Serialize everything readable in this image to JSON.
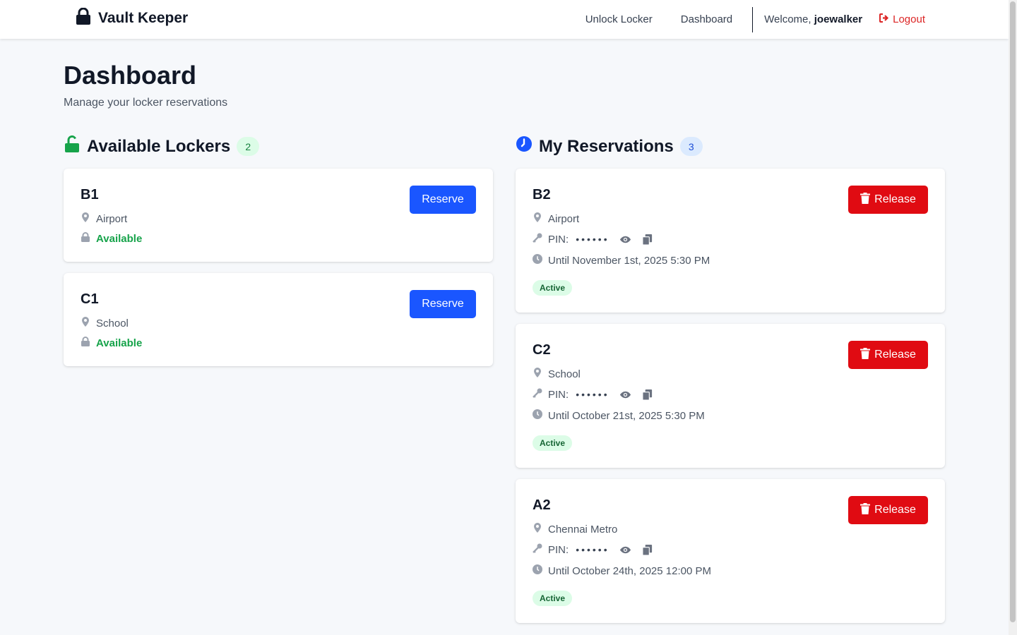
{
  "nav": {
    "brand": "Vault Keeper",
    "links": [
      "Unlock Locker",
      "Dashboard"
    ],
    "welcome_prefix": "Welcome, ",
    "username": "joewalker",
    "logout": "Logout"
  },
  "page": {
    "title": "Dashboard",
    "subtitle": "Manage your locker reservations"
  },
  "available": {
    "heading": "Available Lockers",
    "count": "2",
    "lockers": [
      {
        "name": "B1",
        "location": "Airport",
        "status": "Available",
        "action": "Reserve"
      },
      {
        "name": "C1",
        "location": "School",
        "status": "Available",
        "action": "Reserve"
      }
    ]
  },
  "reservations": {
    "heading": "My Reservations",
    "count": "3",
    "items": [
      {
        "name": "B2",
        "location": "Airport",
        "pin_label": "PIN:",
        "pin_mask": "••••••",
        "until": "Until November 1st, 2025 5:30 PM",
        "status": "Active",
        "action": "Release"
      },
      {
        "name": "C2",
        "location": "School",
        "pin_label": "PIN:",
        "pin_mask": "••••••",
        "until": "Until October 21st, 2025 5:30 PM",
        "status": "Active",
        "action": "Release"
      },
      {
        "name": "A2",
        "location": "Chennai Metro",
        "pin_label": "PIN:",
        "pin_mask": "••••••",
        "until": "Until October 24th, 2025 12:00 PM",
        "status": "Active",
        "action": "Release"
      }
    ]
  },
  "colors": {
    "primary": "#1a56ff",
    "danger": "#e00b12",
    "success": "#16a34a",
    "logout": "#dc2626"
  },
  "icons": {
    "brand": "lock-icon",
    "available_heading": "lock-open-icon",
    "reservations_heading": "clock-icon",
    "location": "map-pin-icon",
    "status": "lock-icon",
    "pin": "key-icon",
    "show_pin": "eye-icon",
    "copy_pin": "copy-icon",
    "until": "clock-icon",
    "release": "trash-icon",
    "logout": "logout-icon"
  }
}
